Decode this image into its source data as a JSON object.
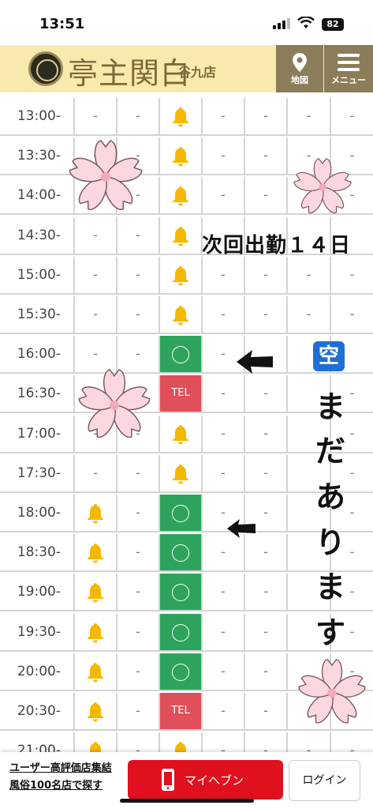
{
  "status_bar": {
    "time": "13:51",
    "battery": "82"
  },
  "header": {
    "logo_text": "亭主関白",
    "branch": "谷九店",
    "map_label": "地図",
    "menu_label": "メニュー"
  },
  "schedule": {
    "rows": [
      {
        "time": "13:00-",
        "cells": [
          "-",
          "-",
          "bell",
          "-",
          "-",
          "-",
          "-"
        ]
      },
      {
        "time": "13:30-",
        "cells": [
          "-",
          "-",
          "bell",
          "-",
          "-",
          "-",
          "-"
        ]
      },
      {
        "time": "14:00-",
        "cells": [
          "-",
          "-",
          "bell",
          "-",
          "-",
          "-",
          "-"
        ]
      },
      {
        "time": "14:30-",
        "cells": [
          "-",
          "-",
          "bell",
          "",
          "",
          "",
          ""
        ]
      },
      {
        "time": "15:00-",
        "cells": [
          "-",
          "-",
          "bell",
          "-",
          "-",
          "-",
          "-"
        ]
      },
      {
        "time": "15:30-",
        "cells": [
          "-",
          "-",
          "bell",
          "-",
          "-",
          "-",
          "-"
        ]
      },
      {
        "time": "16:00-",
        "cells": [
          "-",
          "-",
          "ok",
          "-",
          "",
          "",
          ""
        ]
      },
      {
        "time": "16:30-",
        "cells": [
          "-",
          "-",
          "tel",
          "-",
          "-",
          "",
          "-"
        ]
      },
      {
        "time": "17:00-",
        "cells": [
          "-",
          "-",
          "bell",
          "-",
          "-",
          "",
          "-"
        ]
      },
      {
        "time": "17:30-",
        "cells": [
          "-",
          "-",
          "bell",
          "-",
          "-",
          "",
          "-"
        ]
      },
      {
        "time": "18:00-",
        "cells": [
          "bell",
          "-",
          "ok",
          "-",
          "-",
          "",
          "-"
        ]
      },
      {
        "time": "18:30-",
        "cells": [
          "bell",
          "-",
          "ok",
          "-",
          "-",
          "",
          "-"
        ]
      },
      {
        "time": "19:00-",
        "cells": [
          "bell",
          "-",
          "ok",
          "-",
          "-",
          "",
          "-"
        ]
      },
      {
        "time": "19:30-",
        "cells": [
          "bell",
          "-",
          "ok",
          "-",
          "-",
          "",
          "-"
        ]
      },
      {
        "time": "20:00-",
        "cells": [
          "bell",
          "-",
          "ok",
          "-",
          "-",
          "",
          "-"
        ]
      },
      {
        "time": "20:30-",
        "cells": [
          "bell",
          "-",
          "tel",
          "-",
          "-",
          "",
          "-"
        ]
      },
      {
        "time": "21:00-",
        "cells": [
          "bell",
          "-",
          "bell",
          "-",
          "-",
          "-",
          "-"
        ]
      }
    ],
    "tel_label": "TEL"
  },
  "overlay": {
    "next_shift": "次回出勤１４日",
    "kuu": "空",
    "vertical_chars": [
      "ま",
      "だ",
      "あ",
      "り",
      "ま",
      "す"
    ]
  },
  "bottom_bar": {
    "promo_line1": "ユーザー高評価店集結",
    "promo_line2": "風俗100名店で探す",
    "myheaven_label": "マイヘブン",
    "login_label": "ログイン"
  },
  "colors": {
    "available": "#2ea35e",
    "tel": "#e0505a",
    "bell": "#f5b800",
    "header_bg": "#f8e9ad",
    "accent_red": "#e0101f"
  }
}
